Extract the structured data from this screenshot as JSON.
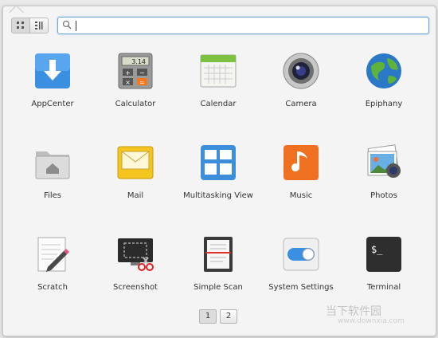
{
  "view_buttons": [
    {
      "name": "grid-view",
      "icon": "grid-icon"
    },
    {
      "name": "category-view",
      "icon": "list-icon"
    }
  ],
  "search": {
    "placeholder": "",
    "value": ""
  },
  "apps": [
    {
      "label": "AppCenter",
      "icon": "appcenter-icon"
    },
    {
      "label": "Calculator",
      "icon": "calculator-icon",
      "display": "3.14"
    },
    {
      "label": "Calendar",
      "icon": "calendar-icon"
    },
    {
      "label": "Camera",
      "icon": "camera-icon"
    },
    {
      "label": "Epiphany",
      "icon": "epiphany-icon"
    },
    {
      "label": "Files",
      "icon": "files-icon"
    },
    {
      "label": "Mail",
      "icon": "mail-icon"
    },
    {
      "label": "Multitasking View",
      "icon": "multitasking-icon"
    },
    {
      "label": "Music",
      "icon": "music-icon"
    },
    {
      "label": "Photos",
      "icon": "photos-icon"
    },
    {
      "label": "Scratch",
      "icon": "scratch-icon"
    },
    {
      "label": "Screenshot",
      "icon": "screenshot-icon"
    },
    {
      "label": "Simple Scan",
      "icon": "simple-scan-icon"
    },
    {
      "label": "System Settings",
      "icon": "settings-icon"
    },
    {
      "label": "Terminal",
      "icon": "terminal-icon",
      "prompt": "$_"
    }
  ],
  "pages": [
    "1",
    "2"
  ],
  "current_page": "1",
  "watermark": {
    "brand": "当下软件园",
    "url": "www.downxia.com"
  }
}
